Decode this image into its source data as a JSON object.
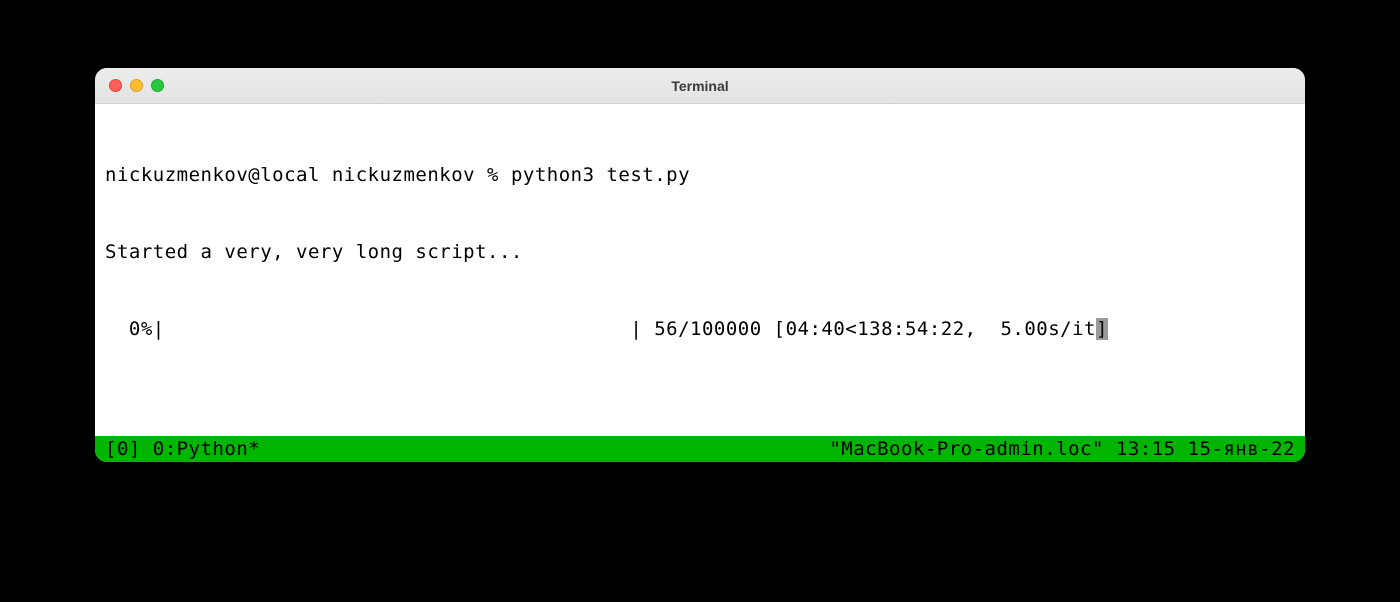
{
  "window": {
    "title": "Terminal"
  },
  "terminal": {
    "prompt": "nickuzmenkov@local nickuzmenkov % ",
    "command": "python3 test.py",
    "output_line": "Started a very, very long script...",
    "progress": {
      "percent": "  0%",
      "bar_left": "|",
      "bar_fill": "                                       ",
      "bar_right": "| ",
      "counter": "56/100000",
      "timing": " [04:40<138:54:22,  5.00s/it",
      "cursor_char": "]"
    }
  },
  "status": {
    "left": "[0] 0:Python*",
    "hostname": "\"MacBook-Pro-admin.loc\"",
    "time": "13:15",
    "date": "15-янв-22"
  }
}
